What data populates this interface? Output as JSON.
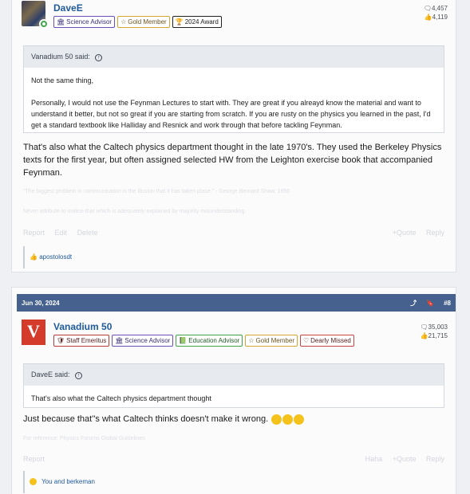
{
  "post1": {
    "author": {
      "name": "DaveE",
      "messages": "4,457",
      "reactions": "4,119"
    },
    "badges": [
      {
        "label": "Science Advisor",
        "type": "sci"
      },
      {
        "label": "Gold Member",
        "type": "gold"
      },
      {
        "label": "2024 Award",
        "type": "award"
      }
    ],
    "quote": {
      "attribution": "Vanadium 50 said:",
      "lines": [
        "Not the same thing,",
        "Personally, I would not use the Feynman Lectures to start with. They are great if you alreayd know the material and want to understand it better, but not so great if you are starting from scratch. If you are rusty on the physics you learned in the past, I'd get a standard textbook like Halliday and Resnick and work through that before tackling Feynman."
      ]
    },
    "message": "That's also what the Caltech physics department thought in the late 1970's. They used the Berkeley Physics texts for the first year, but often assigned selected HW from the Leighton exercise book that accompanied Feynman.",
    "signature": [
      "\"The biggest problem in communication is the illusion that it has taken place.\" - George Bernard Shaw, 1856",
      "Never attribute to malice that which is adequately explained by majority misunderstanding."
    ],
    "actions_left": [
      "Report",
      "Edit",
      "Delete"
    ],
    "actions_right": [
      "+Quote",
      "Reply"
    ],
    "reactions_text": "apostolosdt"
  },
  "post2": {
    "date": "Jun 30, 2024",
    "post_number": "#8",
    "author": {
      "name": "Vanadium 50",
      "messages": "35,003",
      "reactions": "21,715",
      "avatar_letter": "V",
      "avatar_small": "50"
    },
    "badges": [
      {
        "label": "Staff Emeritus",
        "type": "staff"
      },
      {
        "label": "Science Advisor",
        "type": "sci"
      },
      {
        "label": "Education Advisor",
        "type": "edu"
      },
      {
        "label": "Gold Member",
        "type": "gold"
      },
      {
        "label": "Dearly Missed",
        "type": "missed"
      }
    ],
    "quote": {
      "attribution": "DaveE said:",
      "lines": [
        "That's also what the Caltech physics department thought"
      ]
    },
    "message": "Just because that''s what Caltech thinks doesn't make it wrong.",
    "signature": [
      "For reference: Physics Forums Global Guidelines"
    ],
    "actions_left": [
      "Report"
    ],
    "actions_right": [
      "Haha",
      "+Quote",
      "Reply"
    ],
    "reactions_text": "You and berkeman"
  },
  "colors": {
    "header": "#46618d",
    "link": "#1f5a9b",
    "accent_red": "#d43b2b"
  },
  "icons": [
    "message-icon",
    "thumbs-up-icon",
    "arrow-up-icon",
    "share-icon",
    "bookmark-icon",
    "online-icon"
  ]
}
